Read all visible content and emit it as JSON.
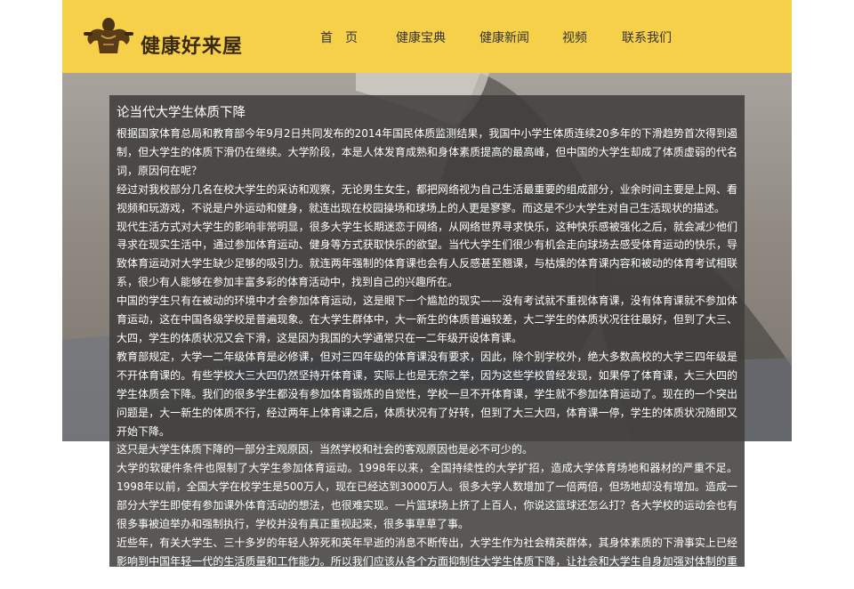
{
  "header": {
    "logo_text": "健康好来屋",
    "logo_icon": "muscleman-icon",
    "nav": [
      "首　页",
      "健康宝典",
      "健康新闻",
      "视频",
      "联系我们"
    ]
  },
  "hero": {
    "icon": "workout-photo"
  },
  "article": {
    "title": "论当代大学生体质下降",
    "paragraphs": [
      "根据国家体育总局和教育部今年9月2日共同发布的2014年国民体质监测结果，我国中小学生体质连续20多年的下滑趋势首次得到遏制，但大学生的体质下滑仍在继续。大学阶段，本是人体发育成熟和身体素质提高的最高峰，但中国的大学生却成了体质虚弱的代名词，原因何在呢？",
      "经过对我校部分几名在校大学生的采访和观察，无论男生女生，都把网络视为自己生活最重要的组成部分，业余时间主要是上网、看视频和玩游戏，不说是户外运动和健身，就连出现在校园操场和球场上的人更是寥寥。而这是不少大学生对自己生活现状的描述。",
      "  现代生活方式对大学生的影响非常明显，很多大学生长期迷恋于网络，从网络世界寻求快乐，这种快乐感被强化之后，就会减少他们寻求在现实生活中，通过参加体育运动、健身等方式获取快乐的欲望。当代大学生们很少有机会走向球场去感受体育运动的快乐，导致体育运动对大学生缺少足够的吸引力。就连两年强制的体育课也会有人反感甚至翘课，与枯燥的体育课内容和被动的体育考试相联系，很少有人能够在参加丰富多彩的体育活动中，找到自己的兴趣所在。",
      "中国的学生只有在被动的环境中才会参加体育运动，这是眼下一个尴尬的现实——没有考试就不重视体育课，没有体育课就不参加体育运动，这在中国各级学校是普遍现象。在大学生群体中，大一新生的体质普遍较差，大二学生的体质状况往往最好，但到了大三、大四，学生的体质状况又会下滑，这是因为我国的大学通常只在一二年级开设体育课。",
      "教育部规定，大学一二年级体育是必修课，但对三四年级的体育课没有要求，因此，除个别学校外，绝大多数高校的大学三四年级是不开体育课的。有些学校大三大四仍然坚持开体育课，实际上也是无奈之举，因为这些学校曾经发现，如果停了体育课，大三大四的学生体质会下降。我们的很多学生都没有参加体育锻炼的自觉性，学校一旦不开体育课，学生就不参加体育运动了。现在的一个突出问题是，大一新生的体质不行，经过两年上体育课之后，体质状况有了好转，但到了大三大四，体育课一停，学生的体质状况随即又开始下降。",
      "这只是大学生体质下降的一部分主观原因，当然学校和社会的客观原因也是必不可少的。",
      "大学的软硬件条件也限制了大学生参加体育运动。1998年以来，全国持续性的大学扩招，造成大学体育场地和器材的严重不足。1998年以前，全国大学在校学生是500万人，现在已经达到3000万人。很多大学人数增加了一倍两倍，但场地却没有增加。造成一部分大学生即使有参加课外体育活动的想法，也很难实现。一片篮球场上挤了上百人，你说这篮球还怎么打？各大学校的运动会也有很多事被迫举办和强制执行，学校并没有真正重视起来，很多事草草了事。",
      " 近些年，有关大学生、三十多岁的年轻人猝死和英年早逝的消息不断传出，大学生作为社会精英群体，其身体素质的下滑事实上已经影响到中国年轻一代的生活质量和工作能力。所以我们应该从各个方面抑制住大学生体质下降，让社会和大学生自身加强对体制的重视，加强锻炼。"
    ]
  }
}
